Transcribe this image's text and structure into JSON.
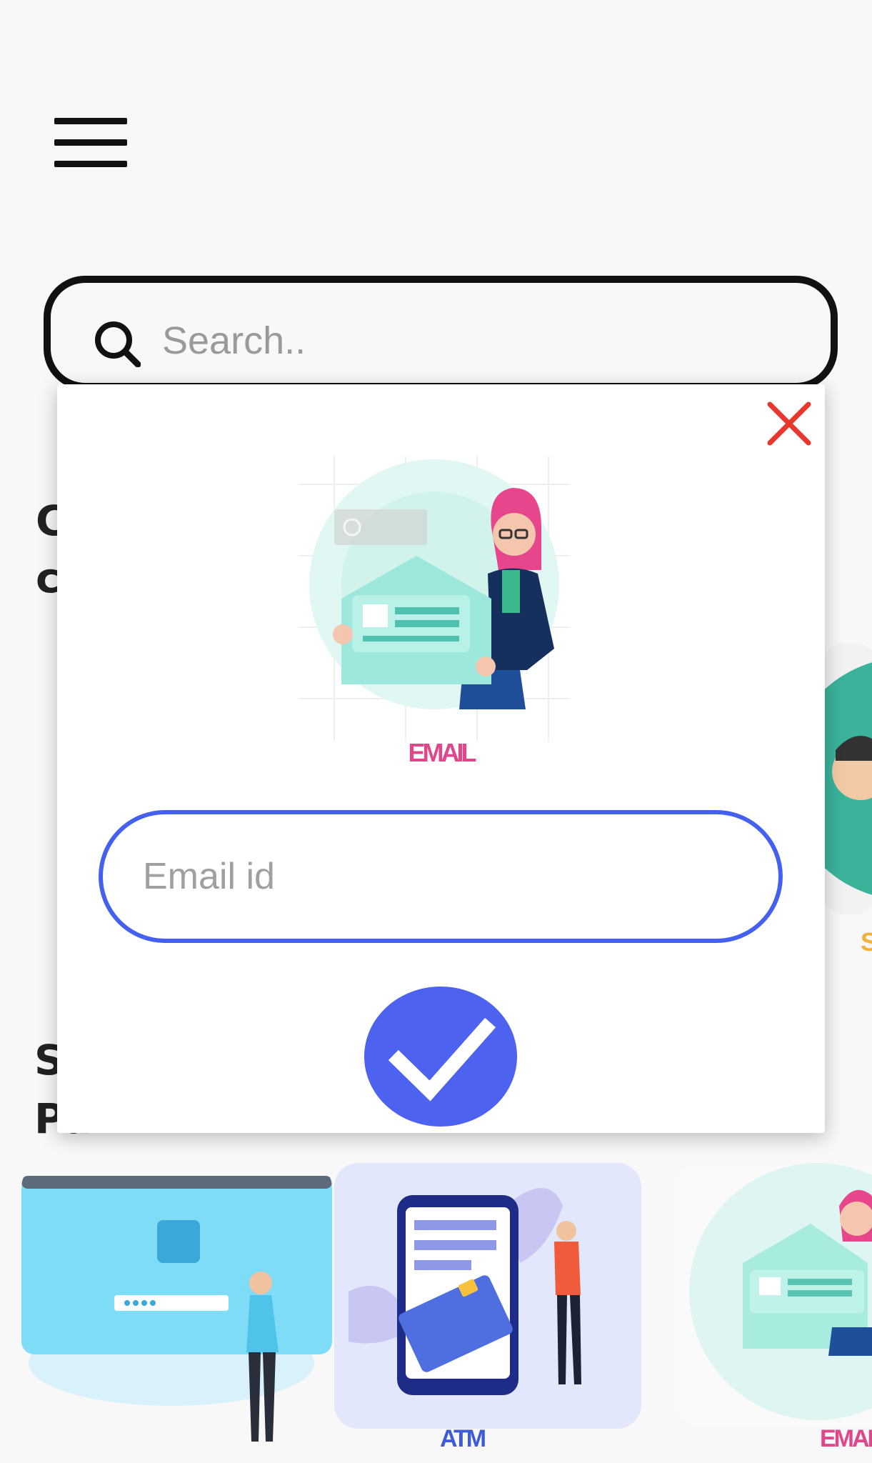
{
  "search": {
    "placeholder": "Search.."
  },
  "background": {
    "section2_line1": "S",
    "section2_line2": "Pa",
    "cards": [
      {
        "label": ""
      },
      {
        "label": "ATM",
        "color": "#3d5bd6"
      },
      {
        "label": "EMAIL",
        "color": "#e0468a"
      }
    ]
  },
  "modal": {
    "illustration_label": "EMAIL",
    "email_placeholder": "Email id",
    "close_color": "#e8372c",
    "submit_color": "#4d63ef",
    "input_border_color": "#4361ee"
  }
}
